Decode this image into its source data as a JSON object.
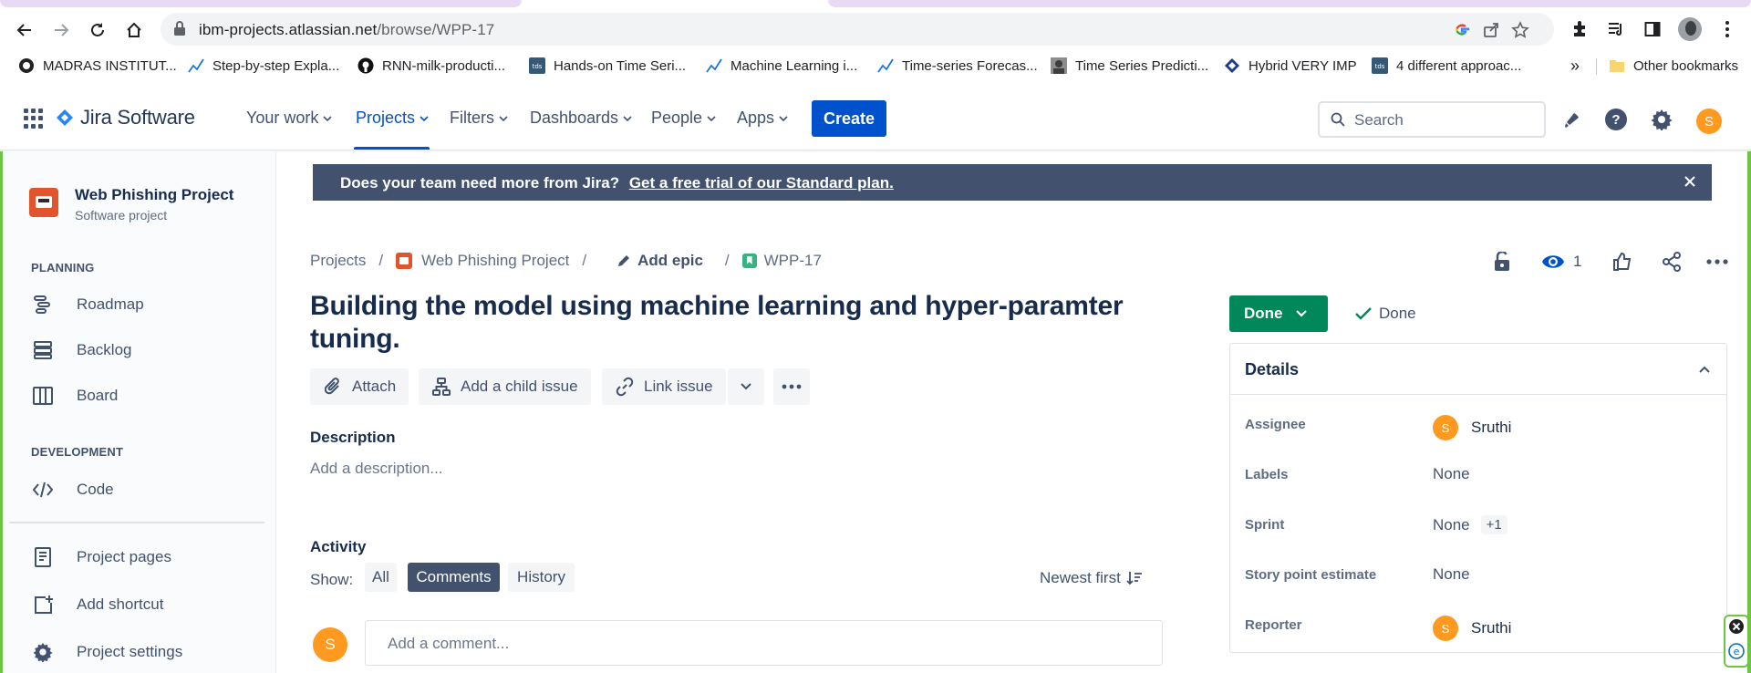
{
  "browser": {
    "url_host": "ibm-projects.atlassian.net",
    "url_path": "/browse/WPP-17",
    "bookmarks": [
      {
        "label": "MADRAS INSTITUT...",
        "icon": "institute-logo-icon"
      },
      {
        "label": "Step-by-step Expla...",
        "icon": "trend-icon"
      },
      {
        "label": "RNN-milk-producti...",
        "icon": "github-icon"
      },
      {
        "label": "Hands-on Time Seri...",
        "icon": "tds-icon"
      },
      {
        "label": "Machine Learning i...",
        "icon": "trend-icon"
      },
      {
        "label": "Time-series Forecas...",
        "icon": "trend-icon"
      },
      {
        "label": "Time Series Predicti...",
        "icon": "profile-photo-icon"
      },
      {
        "label": "Hybrid VERY IMP",
        "icon": "diamond-logo-icon"
      },
      {
        "label": "4 different approac...",
        "icon": "tds-icon"
      }
    ],
    "more_bookmarks": "»",
    "other_bookmarks": "Other bookmarks"
  },
  "jira": {
    "product_name": "Jira Software",
    "nav": [
      {
        "label": "Your work"
      },
      {
        "label": "Projects"
      },
      {
        "label": "Filters"
      },
      {
        "label": "Dashboards"
      },
      {
        "label": "People"
      },
      {
        "label": "Apps"
      }
    ],
    "create_label": "Create",
    "search_placeholder": "Search",
    "user_initial": "S"
  },
  "sidebar": {
    "project_name": "Web Phishing Project",
    "project_type": "Software project",
    "planning_heading": "PLANNING",
    "planning_items": [
      {
        "label": "Roadmap"
      },
      {
        "label": "Backlog"
      },
      {
        "label": "Board"
      }
    ],
    "development_heading": "DEVELOPMENT",
    "development_items": [
      {
        "label": "Code"
      }
    ],
    "footer_items": [
      {
        "label": "Project pages"
      },
      {
        "label": "Add shortcut"
      },
      {
        "label": "Project settings"
      }
    ]
  },
  "banner": {
    "message": "Does your team need more from Jira?",
    "link": "Get a free trial of our Standard plan."
  },
  "breadcrumb": {
    "projects": "Projects",
    "project": "Web Phishing Project",
    "add_epic": "Add epic",
    "issue_key": "WPP-17",
    "separator": "/"
  },
  "issue": {
    "title": "Building the model using machine learning and hyper-paramter tuning.",
    "watch_count": "1",
    "actions": {
      "attach": "Attach",
      "add_child": "Add a child issue",
      "link_issue": "Link issue"
    },
    "description_label": "Description",
    "description_placeholder": "Add a description...",
    "activity_label": "Activity",
    "show_label": "Show:",
    "filters": [
      "All",
      "Comments",
      "History"
    ],
    "selected_filter": "Comments",
    "sort_label": "Newest first",
    "comment_avatar": "S",
    "comment_placeholder": "Add a comment..."
  },
  "status": {
    "label": "Done",
    "resolution": "Done",
    "color": "#00875a"
  },
  "details": {
    "title": "Details",
    "rows": [
      {
        "label": "Assignee",
        "value": "Sruthi",
        "avatar": "S"
      },
      {
        "label": "Labels",
        "value": "None"
      },
      {
        "label": "Sprint",
        "value": "None",
        "extra": "+1"
      },
      {
        "label": "Story point estimate",
        "value": "None"
      },
      {
        "label": "Reporter",
        "value": "Sruthi",
        "avatar": "S"
      }
    ]
  },
  "colors": {
    "brand_blue": "#0052cc",
    "banner_bg": "#42526e",
    "avatar_orange": "#ff991f",
    "done_green": "#00875a"
  }
}
